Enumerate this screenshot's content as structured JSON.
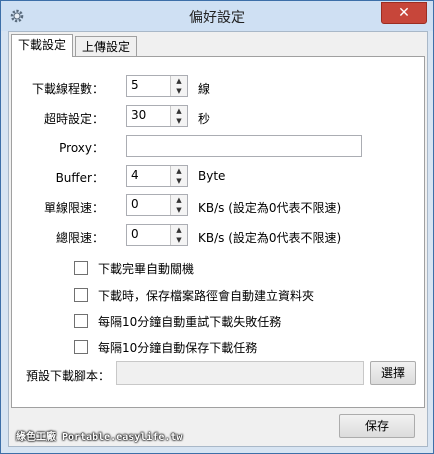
{
  "window": {
    "title": "偏好設定",
    "close_label": "✕"
  },
  "tabs": [
    {
      "label": "下載設定",
      "active": true
    },
    {
      "label": "上傳設定",
      "active": false
    }
  ],
  "download": {
    "threads": {
      "label": "下載線程數：",
      "value": "5",
      "unit": "線"
    },
    "timeout": {
      "label": "超時設定：",
      "value": "30",
      "unit": "秒"
    },
    "proxy": {
      "label": "Proxy：",
      "value": ""
    },
    "buffer": {
      "label": "Buffer：",
      "value": "4",
      "unit": "Byte"
    },
    "single_limit": {
      "label": "單線限速：",
      "value": "0",
      "unit": "KB/s (設定為0代表不限速)"
    },
    "total_limit": {
      "label": "總限速：",
      "value": "0",
      "unit": "KB/s (設定為0代表不限速)"
    },
    "options": [
      {
        "label": "下載完畢自動關機",
        "checked": false
      },
      {
        "label": "下載時，保存檔案路徑會自動建立資料夾",
        "checked": false
      },
      {
        "label": "每隔10分鐘自動重試下載失敗任務",
        "checked": false
      },
      {
        "label": "每隔10分鐘自動保存下載任務",
        "checked": false
      }
    ],
    "script": {
      "label": "預設下載腳本：",
      "value": "",
      "browse_label": "選擇"
    }
  },
  "footer": {
    "save_label": "保存"
  },
  "watermark": "綠色工廠 Portable.easylife.tw"
}
